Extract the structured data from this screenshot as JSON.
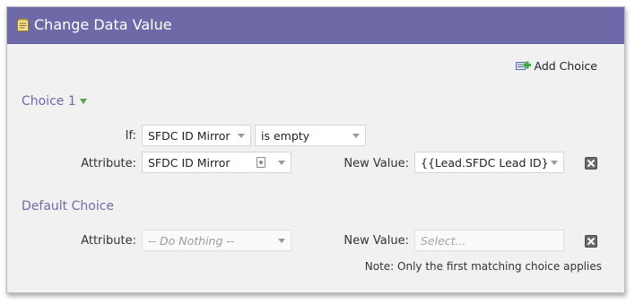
{
  "dialog": {
    "title": "Change Data Value"
  },
  "toolbar": {
    "add_choice_label": "Add Choice"
  },
  "choice1": {
    "title": "Choice 1",
    "if_label": "If:",
    "if_attribute": "SFDC ID Mirror",
    "if_operator": "is empty",
    "attribute_label": "Attribute:",
    "attribute_value": "SFDC ID Mirror",
    "new_value_label": "New Value:",
    "new_value": "{{Lead.SFDC Lead ID}}"
  },
  "default_choice": {
    "title": "Default Choice",
    "attribute_label": "Attribute:",
    "attribute_value": "-- Do Nothing --",
    "new_value_label": "New Value:",
    "new_value_placeholder": "Select..."
  },
  "note": "Note: Only the first matching choice applies",
  "colors": {
    "header": "#6e6aa8",
    "section_title": "#6e6aa8",
    "panel_bg": "#f1f1f1",
    "caret": "#4fa84a"
  }
}
